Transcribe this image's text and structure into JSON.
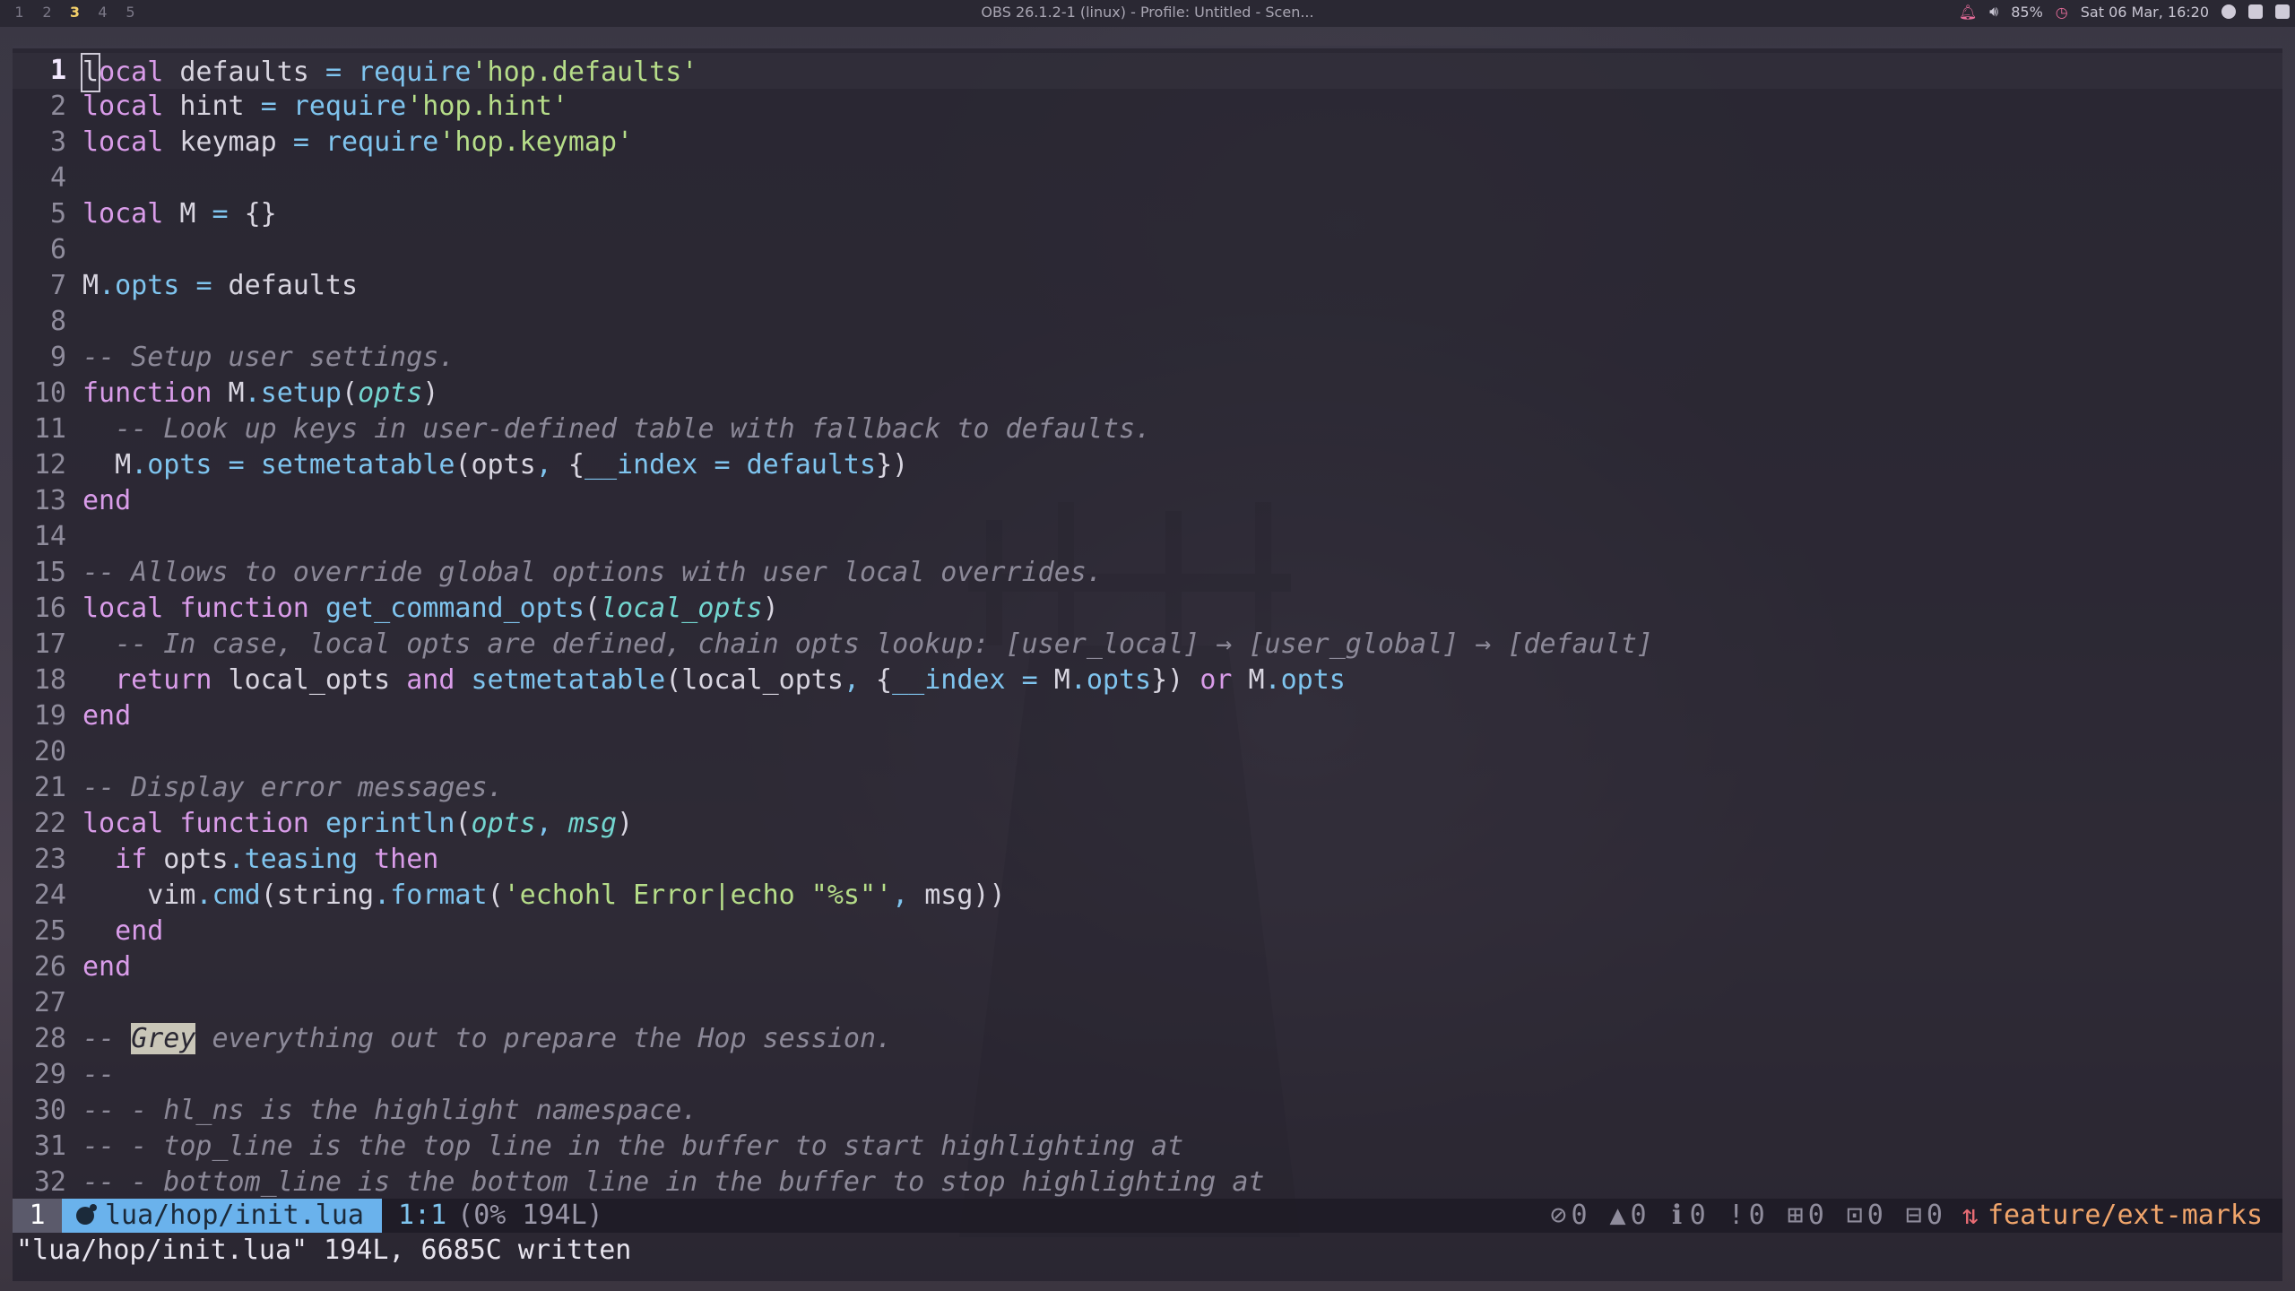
{
  "topbar": {
    "workspaces": [
      "1",
      "2",
      "3",
      "4",
      "5"
    ],
    "active_workspace": "3",
    "window_title": "OBS 26.1.2-1 (linux) - Profile: Untitled - Scen...",
    "volume": "85%",
    "clock": "Sat 06 Mar, 16:20"
  },
  "editor": {
    "lines": [
      {
        "n": "1",
        "tokens": [
          [
            "cursor",
            "l"
          ],
          [
            "kw",
            "ocal"
          ],
          [
            "pl",
            " defaults "
          ],
          [
            "op",
            "="
          ],
          [
            "pl",
            " "
          ],
          [
            "fn",
            "require"
          ],
          [
            "str",
            "'hop.defaults'"
          ]
        ]
      },
      {
        "n": "2",
        "tokens": [
          [
            "kw",
            "local"
          ],
          [
            "pl",
            " hint "
          ],
          [
            "op",
            "="
          ],
          [
            "pl",
            " "
          ],
          [
            "fn",
            "require"
          ],
          [
            "str",
            "'hop.hint'"
          ]
        ]
      },
      {
        "n": "3",
        "tokens": [
          [
            "kw",
            "local"
          ],
          [
            "pl",
            " keymap "
          ],
          [
            "op",
            "="
          ],
          [
            "pl",
            " "
          ],
          [
            "fn",
            "require"
          ],
          [
            "str",
            "'hop.keymap'"
          ]
        ]
      },
      {
        "n": "4",
        "tokens": []
      },
      {
        "n": "5",
        "tokens": [
          [
            "kw",
            "local"
          ],
          [
            "pl",
            " M "
          ],
          [
            "op",
            "="
          ],
          [
            "pl",
            " {}"
          ]
        ]
      },
      {
        "n": "6",
        "tokens": []
      },
      {
        "n": "7",
        "tokens": [
          [
            "pl",
            "M"
          ],
          [
            "op",
            "."
          ],
          [
            "prop",
            "opts"
          ],
          [
            "pl",
            " "
          ],
          [
            "op",
            "="
          ],
          [
            "pl",
            " defaults"
          ]
        ]
      },
      {
        "n": "8",
        "tokens": []
      },
      {
        "n": "9",
        "tokens": [
          [
            "cm",
            "-- Setup user settings."
          ]
        ]
      },
      {
        "n": "10",
        "tokens": [
          [
            "kw",
            "function"
          ],
          [
            "pl",
            " M"
          ],
          [
            "op",
            "."
          ],
          [
            "fn",
            "setup"
          ],
          [
            "pl",
            "("
          ],
          [
            "par",
            "opts"
          ],
          [
            "pl",
            ")"
          ]
        ]
      },
      {
        "n": "11",
        "tokens": [
          [
            "pl",
            "  "
          ],
          [
            "cm",
            "-- Look up keys in user-defined table with fallback to defaults."
          ]
        ]
      },
      {
        "n": "12",
        "tokens": [
          [
            "pl",
            "  M"
          ],
          [
            "op",
            "."
          ],
          [
            "prop",
            "opts"
          ],
          [
            "pl",
            " "
          ],
          [
            "op",
            "="
          ],
          [
            "pl",
            " "
          ],
          [
            "fn",
            "setmetatable"
          ],
          [
            "pl",
            "(opts"
          ],
          [
            "op",
            ","
          ],
          [
            "pl",
            " {"
          ],
          [
            "prop",
            "__index"
          ],
          [
            "pl",
            " "
          ],
          [
            "op",
            "="
          ],
          [
            "pl",
            " "
          ],
          [
            "prop",
            "defaults"
          ],
          [
            "pl",
            "})"
          ]
        ]
      },
      {
        "n": "13",
        "tokens": [
          [
            "kw",
            "end"
          ]
        ]
      },
      {
        "n": "14",
        "tokens": []
      },
      {
        "n": "15",
        "tokens": [
          [
            "cm",
            "-- Allows to override global options with user local overrides."
          ]
        ]
      },
      {
        "n": "16",
        "tokens": [
          [
            "kw",
            "local function"
          ],
          [
            "pl",
            " "
          ],
          [
            "fn",
            "get_command_opts"
          ],
          [
            "pl",
            "("
          ],
          [
            "par",
            "local_opts"
          ],
          [
            "pl",
            ")"
          ]
        ]
      },
      {
        "n": "17",
        "tokens": [
          [
            "pl",
            "  "
          ],
          [
            "cm",
            "-- In case, local opts are defined, chain opts lookup: [user_local] → [user_global] → [default]"
          ]
        ]
      },
      {
        "n": "18",
        "tokens": [
          [
            "pl",
            "  "
          ],
          [
            "kw",
            "return"
          ],
          [
            "pl",
            " local_opts "
          ],
          [
            "kw",
            "and"
          ],
          [
            "pl",
            " "
          ],
          [
            "fn",
            "setmetatable"
          ],
          [
            "pl",
            "(local_opts"
          ],
          [
            "op",
            ","
          ],
          [
            "pl",
            " {"
          ],
          [
            "prop",
            "__index"
          ],
          [
            "pl",
            " "
          ],
          [
            "op",
            "="
          ],
          [
            "pl",
            " M"
          ],
          [
            "op",
            "."
          ],
          [
            "prop",
            "opts"
          ],
          [
            "pl",
            "}) "
          ],
          [
            "kw",
            "or"
          ],
          [
            "pl",
            " M"
          ],
          [
            "op",
            "."
          ],
          [
            "prop",
            "opts"
          ]
        ]
      },
      {
        "n": "19",
        "tokens": [
          [
            "kw",
            "end"
          ]
        ]
      },
      {
        "n": "20",
        "tokens": []
      },
      {
        "n": "21",
        "tokens": [
          [
            "cm",
            "-- Display error messages."
          ]
        ]
      },
      {
        "n": "22",
        "tokens": [
          [
            "kw",
            "local function"
          ],
          [
            "pl",
            " "
          ],
          [
            "fn",
            "eprintln"
          ],
          [
            "pl",
            "("
          ],
          [
            "par",
            "opts"
          ],
          [
            "op",
            ","
          ],
          [
            "pl",
            " "
          ],
          [
            "par",
            "msg"
          ],
          [
            "pl",
            ")"
          ]
        ]
      },
      {
        "n": "23",
        "tokens": [
          [
            "pl",
            "  "
          ],
          [
            "kw",
            "if"
          ],
          [
            "pl",
            " opts"
          ],
          [
            "op",
            "."
          ],
          [
            "prop",
            "teasing"
          ],
          [
            "pl",
            " "
          ],
          [
            "kw",
            "then"
          ]
        ]
      },
      {
        "n": "24",
        "tokens": [
          [
            "pl",
            "    vim"
          ],
          [
            "op",
            "."
          ],
          [
            "fn",
            "cmd"
          ],
          [
            "pl",
            "(string"
          ],
          [
            "op",
            "."
          ],
          [
            "fn",
            "format"
          ],
          [
            "pl",
            "("
          ],
          [
            "str",
            "'echohl Error|echo \"%s\"'"
          ],
          [
            "op",
            ","
          ],
          [
            "pl",
            " msg))"
          ]
        ]
      },
      {
        "n": "25",
        "tokens": [
          [
            "pl",
            "  "
          ],
          [
            "kw",
            "end"
          ]
        ]
      },
      {
        "n": "26",
        "tokens": [
          [
            "kw",
            "end"
          ]
        ]
      },
      {
        "n": "27",
        "tokens": []
      },
      {
        "n": "28",
        "tokens": [
          [
            "cm",
            "-- "
          ],
          [
            "hlword",
            "Grey"
          ],
          [
            "cm",
            " everything out to prepare the Hop session."
          ]
        ]
      },
      {
        "n": "29",
        "tokens": [
          [
            "cm",
            "--"
          ]
        ]
      },
      {
        "n": "30",
        "tokens": [
          [
            "cm",
            "-- - hl_ns is the highlight namespace."
          ]
        ]
      },
      {
        "n": "31",
        "tokens": [
          [
            "cm",
            "-- - top_line is the top line in the buffer to start highlighting at"
          ]
        ]
      },
      {
        "n": "32",
        "tokens": [
          [
            "cm",
            "-- - bottom_line is the bottom line in the buffer to stop highlighting at"
          ]
        ]
      }
    ]
  },
  "statusline": {
    "buffer_number": "1",
    "file_path": "lua/hop/init.lua",
    "position": "1:1",
    "percent": "(0% 194L)",
    "errors": "0",
    "warnings": "0",
    "info": "0",
    "hints": "0",
    "added": "0",
    "modified": "0",
    "removed": "0",
    "branch": "feature/ext-marks"
  },
  "cmdline": {
    "message": "\"lua/hop/init.lua\" 194L, 6685C written"
  },
  "colors": {
    "keyword": "#d99ce9",
    "string": "#b6dd89",
    "function": "#7fc4ee",
    "comment": "#8c8998",
    "statusline_file_bg": "#6ab2ec",
    "branch": "#f0a56b"
  }
}
